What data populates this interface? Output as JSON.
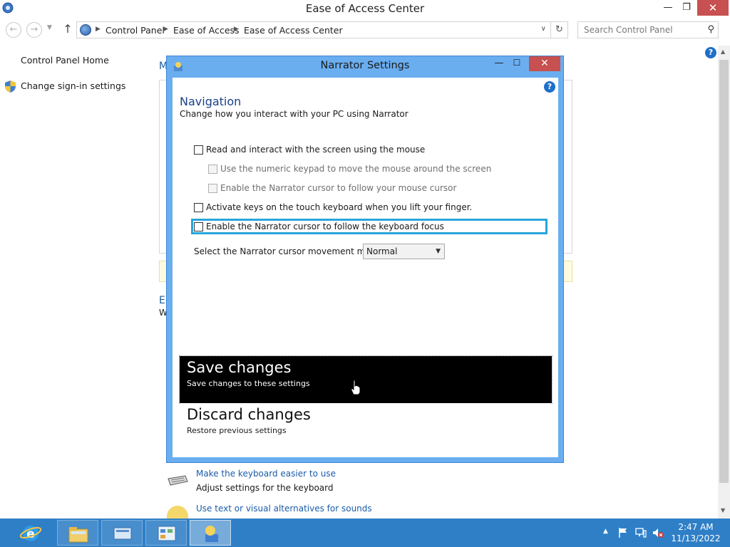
{
  "window": {
    "title": "Ease of Access Center",
    "min_glyph": "—",
    "restore_glyph": "❐",
    "close_glyph": "✕"
  },
  "address": {
    "back_glyph": "←",
    "forward_glyph": "→",
    "history_glyph": "▼",
    "up_glyph": "↑",
    "sep_glyph": "▶",
    "crumbs": [
      "Control Panel",
      "Ease of Access",
      "Ease of Access Center"
    ],
    "dropdown_glyph": "∨",
    "refresh_glyph": "↻",
    "search_placeholder": "Search Control Panel",
    "search_glyph": "⚲"
  },
  "sidebar": {
    "home_label": "Control Panel Home",
    "signin_label": "Change sign-in settings"
  },
  "help_glyph": "?",
  "background": {
    "frag_m": "M",
    "frag_e": "E",
    "frag_w": "W",
    "keyboard_link": "Make the keyboard easier to use",
    "keyboard_desc": "Adjust settings for the keyboard",
    "sound_link": "Use text or visual alternatives for sounds"
  },
  "dialog": {
    "title": "Narrator Settings",
    "min_glyph": "—",
    "max_glyph": "☐",
    "close_glyph": "✕",
    "heading": "Navigation",
    "subheading": "Change how you interact with your PC using Narrator",
    "options": {
      "read": "Read and interact with the screen using the mouse",
      "keypad": "Use the numeric keypad to move the mouse around the screen",
      "follow_mouse": "Enable the Narrator cursor to follow your mouse cursor",
      "touch": "Activate keys on the touch keyboard when you lift your finger.",
      "focus": "Enable the Narrator cursor to follow the keyboard focus"
    },
    "mode_label": "Select the Narrator cursor movement mode:",
    "mode_value": "Normal",
    "mode_arrow": "▼",
    "save_title": "Save changes",
    "save_desc": "Save changes to these settings",
    "discard_title": "Discard changes",
    "discard_desc": "Restore previous settings"
  },
  "scrollbar": {
    "up_glyph": "▲",
    "down_glyph": "▼"
  },
  "taskbar": {
    "tray_chevron": "▲",
    "time": "2:47 AM",
    "date": "11/13/2022"
  },
  "colors": {
    "dialog_frame": "#6aaef0",
    "taskbar": "#2f7fc7",
    "close_red": "#c75050",
    "focus_border": "#27a6dc",
    "link_blue": "#1a5ba8"
  }
}
